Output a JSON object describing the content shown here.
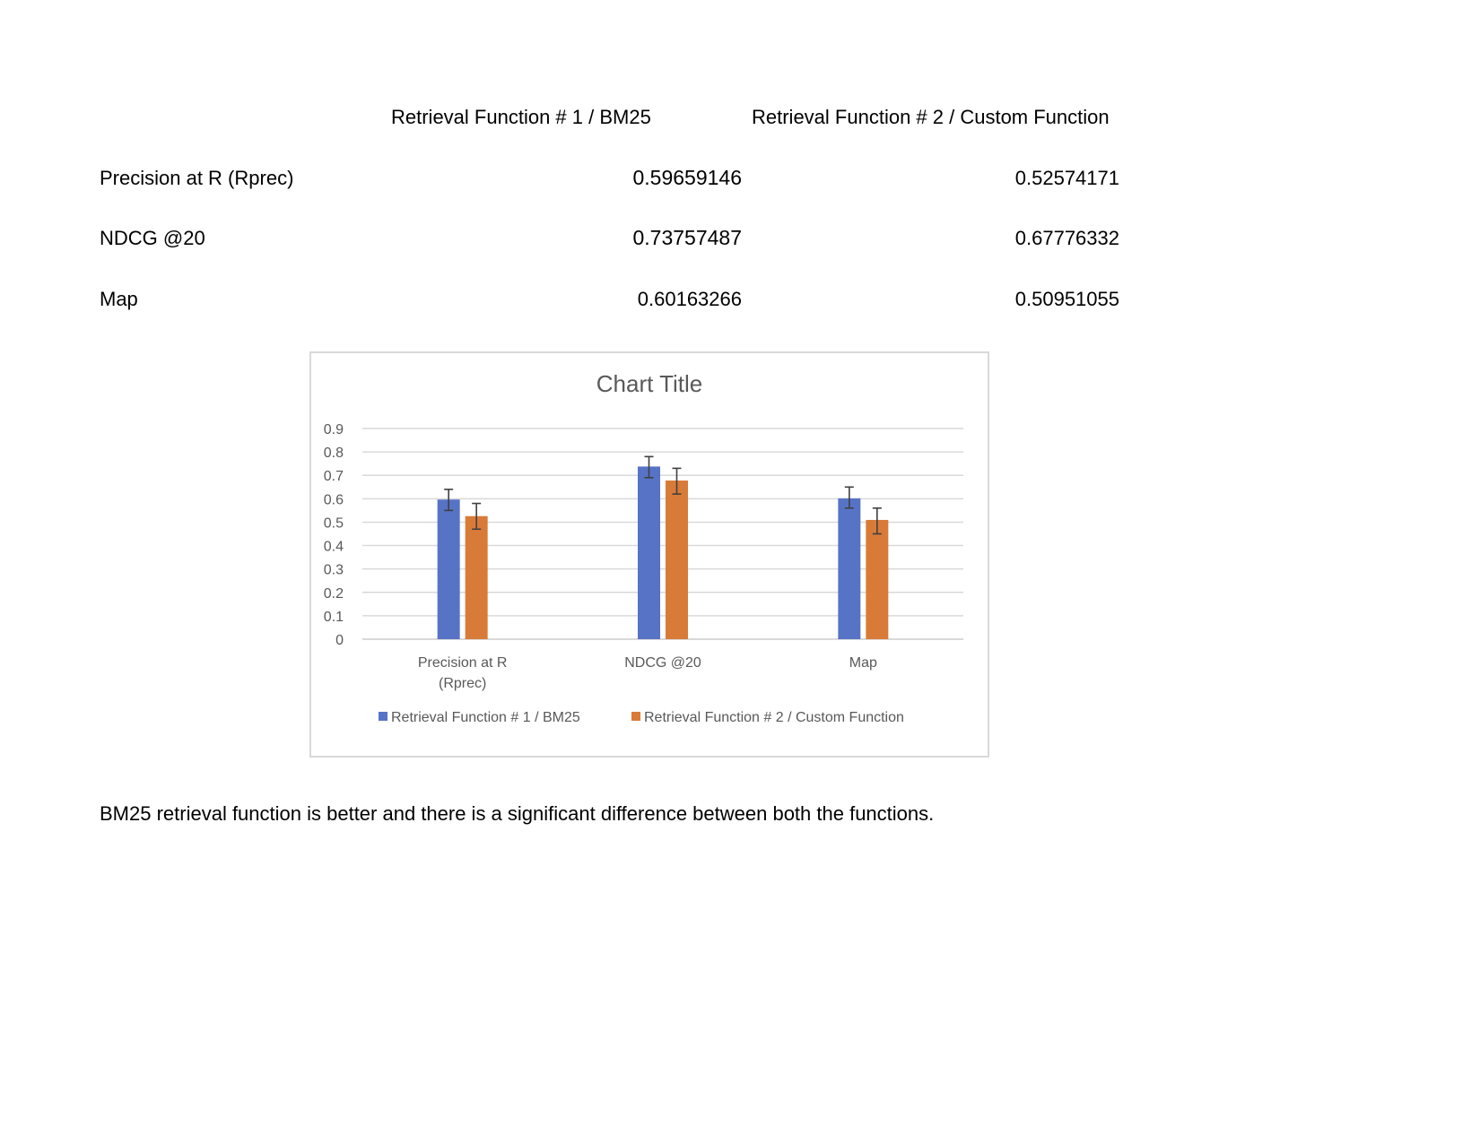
{
  "table": {
    "headers": [
      "Retrieval Function  # 1 / BM25",
      "Retrieval Function # 2 / Custom Function"
    ],
    "rows": [
      {
        "label": "Precision at R (Rprec)",
        "bm25": "0.59659146",
        "custom": "0.52574171"
      },
      {
        "label": "NDCG @20",
        "bm25": "0.73757487",
        "custom": "0.67776332"
      },
      {
        "label": "Map",
        "bm25": "0.60163266",
        "custom": "0.50951055"
      }
    ]
  },
  "chart_data": {
    "type": "bar",
    "title": "Chart Title",
    "categories": [
      "Precision at R (Rprec)",
      "NDCG @20",
      "Map"
    ],
    "category_label_lines": [
      [
        "Precision at R",
        "(Rprec)"
      ],
      [
        "NDCG @20"
      ],
      [
        "Map"
      ]
    ],
    "series": [
      {
        "name": "Retrieval Function  # 1 / BM25",
        "color": "#5773c6",
        "values": [
          0.59659146,
          0.73757487,
          0.60163266
        ],
        "error_low": [
          0.55,
          0.69,
          0.56
        ],
        "error_high": [
          0.64,
          0.78,
          0.65
        ]
      },
      {
        "name": "Retrieval Function # 2 / Custom Function",
        "color": "#d97b38",
        "values": [
          0.52574171,
          0.67776332,
          0.50951055
        ],
        "error_low": [
          0.47,
          0.62,
          0.45
        ],
        "error_high": [
          0.58,
          0.73,
          0.56
        ]
      }
    ],
    "y_ticks": [
      "0",
      "0.1",
      "0.2",
      "0.3",
      "0.4",
      "0.5",
      "0.6",
      "0.7",
      "0.8",
      "0.9"
    ],
    "ylim": [
      0,
      0.9
    ],
    "grid": true,
    "legend_position": "bottom",
    "gridline_color": "#d9d9d9",
    "errorbar_color": "#404040"
  },
  "conclusion": "BM25 retrieval function is better and there is a significant difference between both the functions."
}
